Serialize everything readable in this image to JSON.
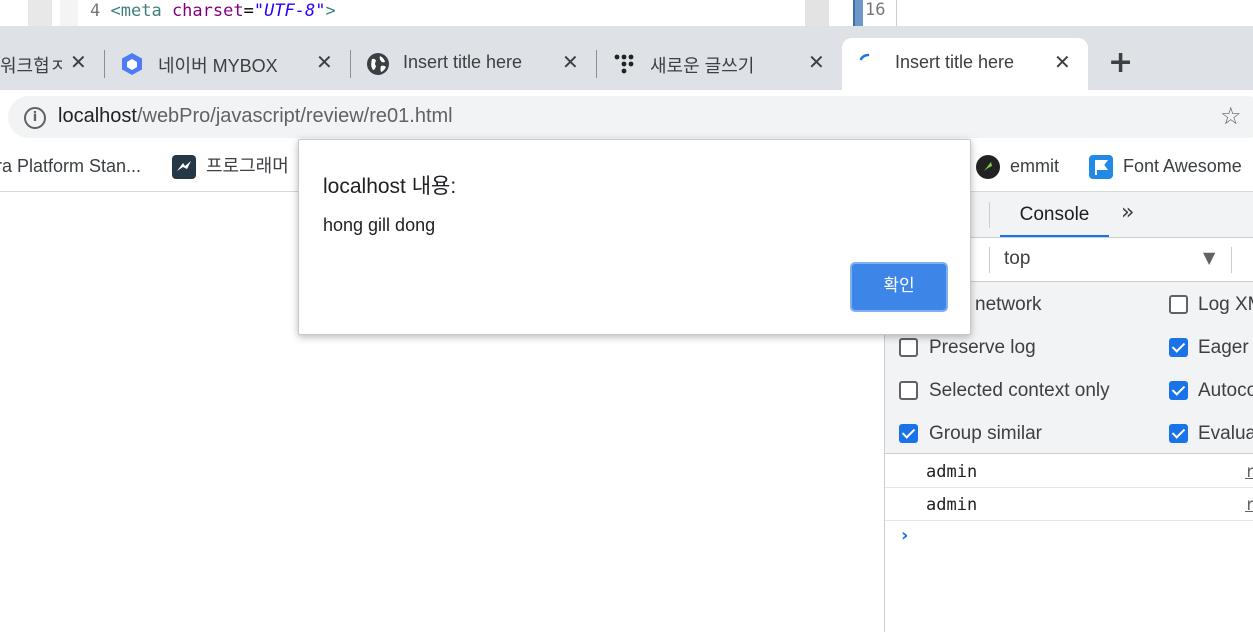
{
  "editor": {
    "line_number": "4",
    "line_tag_open": "<meta",
    "line_attr": "charset",
    "line_equals": "=",
    "line_value": "\"UTF-8\"",
    "line_tag_close": ">",
    "right_line_number": "16"
  },
  "tabs": [
    {
      "title": "워크협ㅈ",
      "icon": "generic-favicon"
    },
    {
      "title": "네이버 MYBOX",
      "icon": "mybox-cube-icon"
    },
    {
      "title": "Insert title here",
      "icon": "globe-icon"
    },
    {
      "title": "새로운 글쓰기",
      "icon": "tistory-dots-icon"
    },
    {
      "title": "Insert title here",
      "icon": "loading-spinner-icon",
      "active": true
    }
  ],
  "new_tab_label": "+",
  "close_glyph": "✕",
  "address_bar": {
    "host": "localhost",
    "path": "/webPro/javascript/review/re01.html"
  },
  "bookmarks": [
    {
      "label": "ra Platform Stan..."
    },
    {
      "label": "프로그래머",
      "icon": "bird-icon"
    },
    {
      "label": "emmit",
      "icon": "emmet-icon"
    },
    {
      "label": "Font Awesome",
      "icon": "flag-icon"
    }
  ],
  "devtools": {
    "tab": "Console",
    "more": "»",
    "context": "top",
    "context_arrow": "▼",
    "settings": [
      {
        "label": "network",
        "checked": null
      },
      {
        "label": "Log XM",
        "checked": false
      },
      {
        "label": "Preserve log",
        "checked": false
      },
      {
        "label": "Eager e",
        "checked": true
      },
      {
        "label": "Selected context only",
        "checked": false
      },
      {
        "label": "Autoco",
        "checked": true
      },
      {
        "label": "Group similar",
        "checked": true
      },
      {
        "label": "Evalua",
        "checked": true
      }
    ],
    "messages": [
      {
        "text": "admin",
        "source": "r"
      },
      {
        "text": "admin",
        "source": "r"
      }
    ],
    "prompt": "›"
  },
  "alert": {
    "title": "localhost 내용:",
    "message": "hong gill dong",
    "ok_label": "확인"
  },
  "colors": {
    "accent": "#1a73e8",
    "ok_button": "#3d86e7",
    "tabstrip": "#dee1e6"
  }
}
